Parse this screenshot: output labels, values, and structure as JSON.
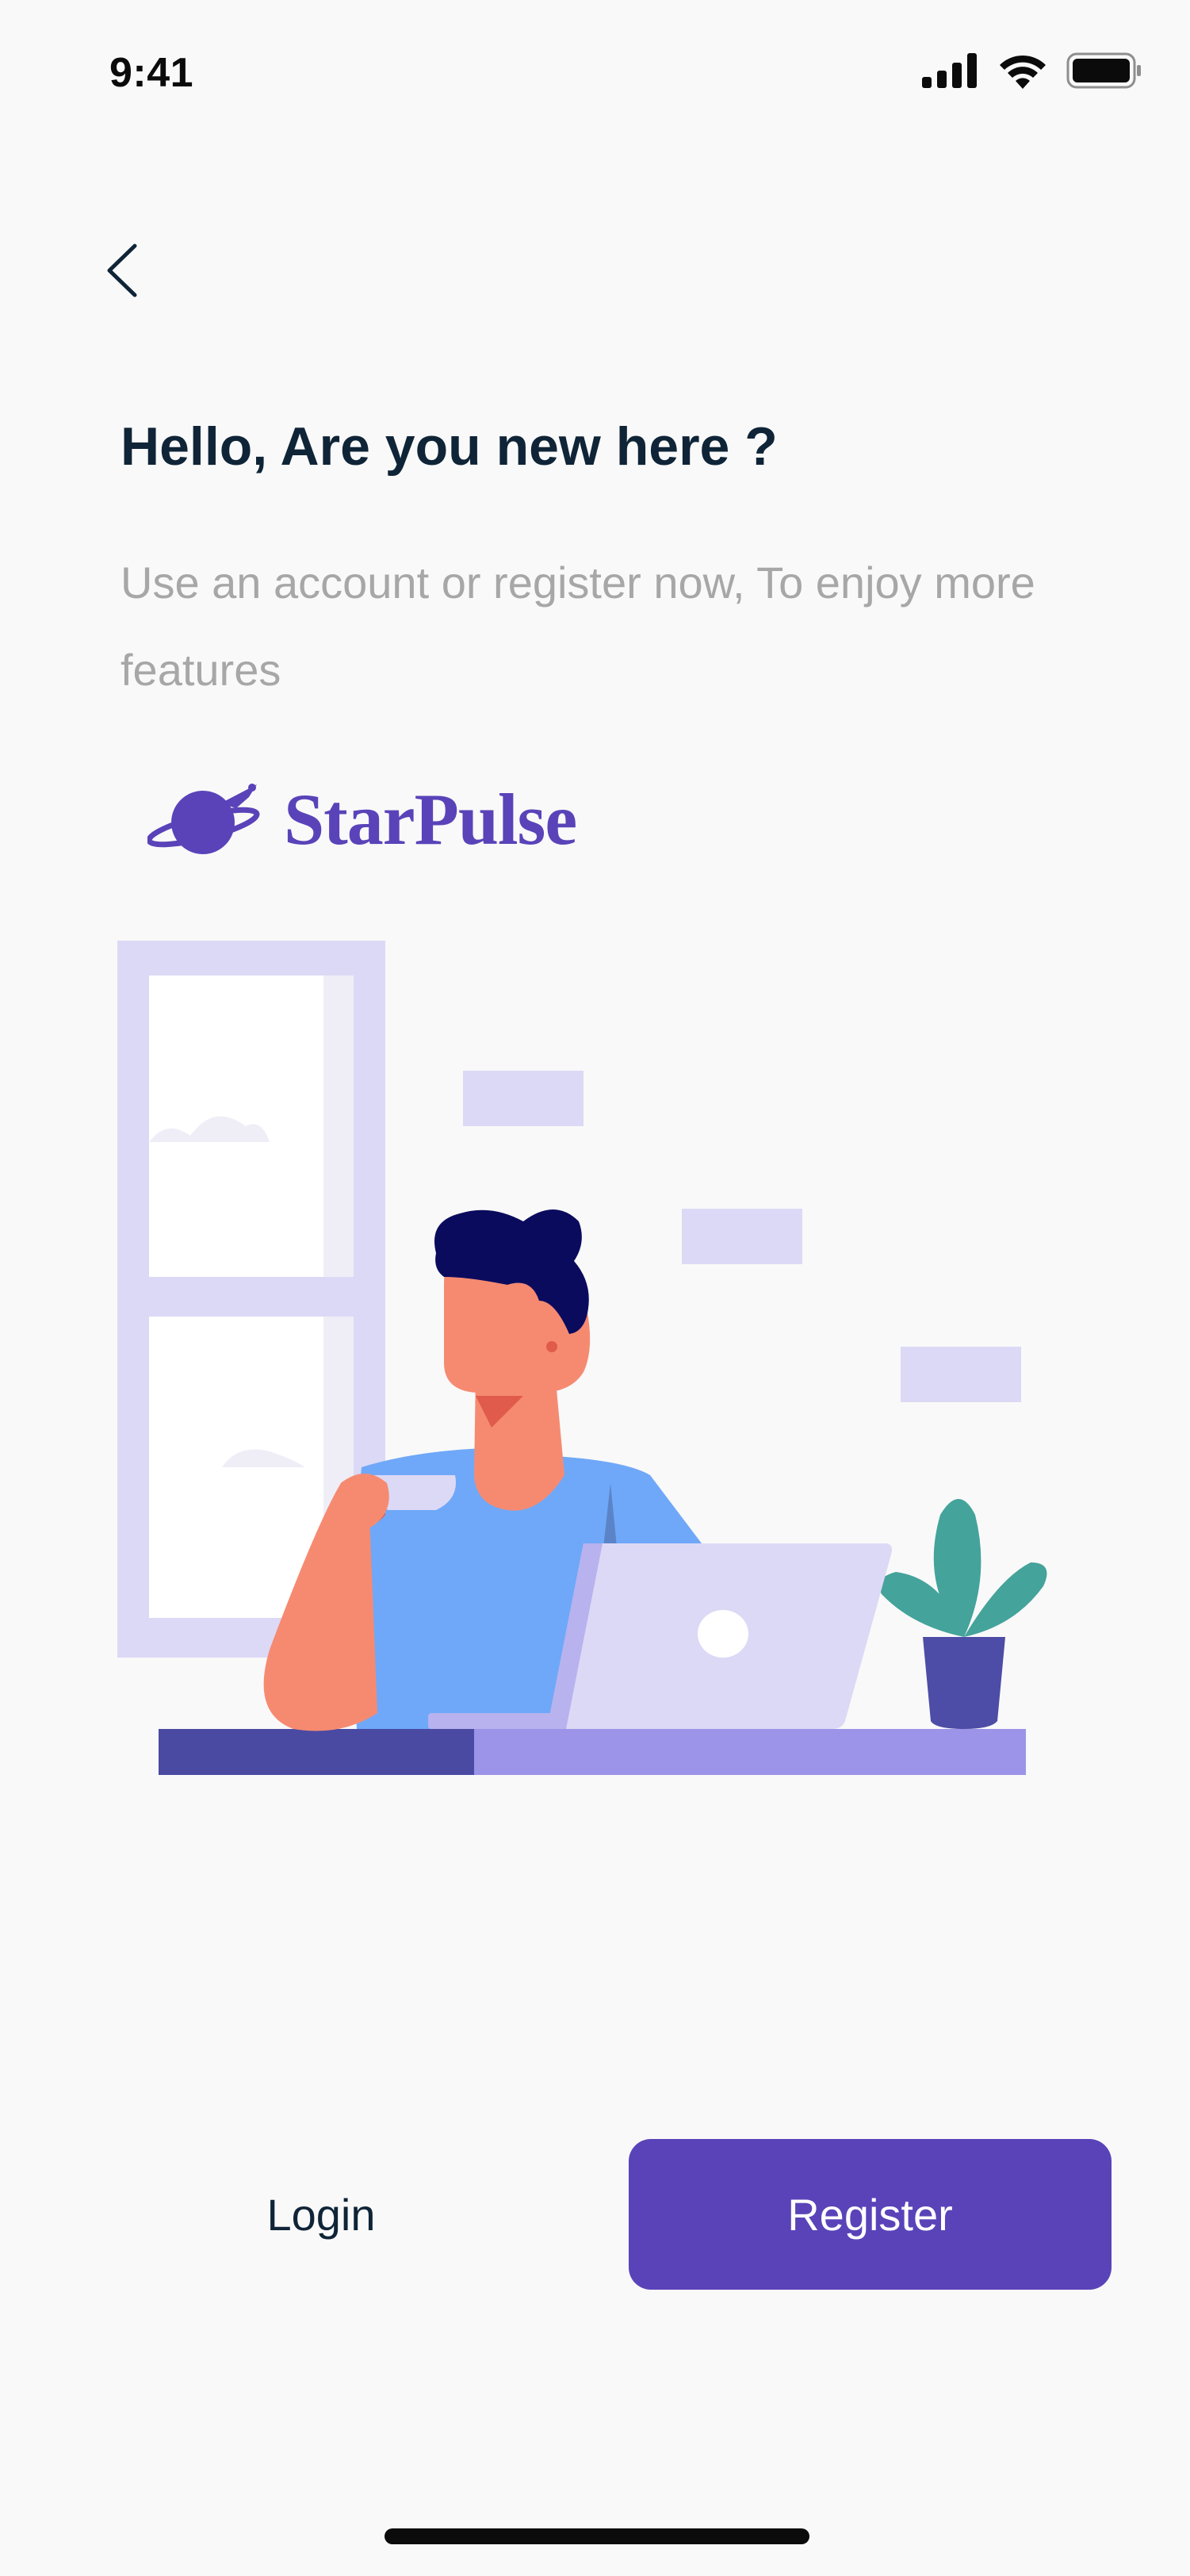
{
  "status_bar": {
    "time": "9:41",
    "icons": [
      "cellular-signal-icon",
      "wifi-icon",
      "battery-icon"
    ]
  },
  "nav": {
    "back_icon": "chevron-left-icon"
  },
  "header": {
    "title": "Hello, Are you new here ?",
    "subtitle": "Use an account or register now, To enjoy more features"
  },
  "brand": {
    "name": "StarPulse",
    "logo_icon": "planet-rocket-icon",
    "color": "#5a43b9"
  },
  "illustration": {
    "name": "man-with-coffee-at-laptop-illustration"
  },
  "actions": {
    "login_label": "Login",
    "register_label": "Register"
  },
  "colors": {
    "primary": "#5a43b9",
    "heading": "#0f2437",
    "muted": "#a7a7a7",
    "background": "#f9f9f9"
  }
}
